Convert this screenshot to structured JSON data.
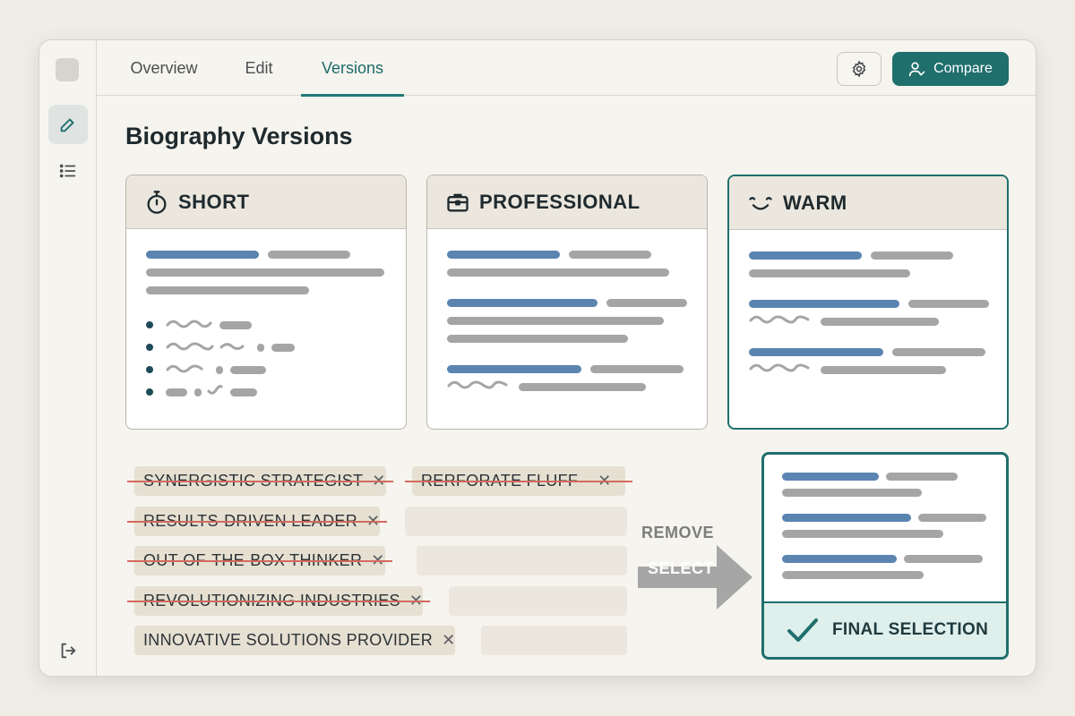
{
  "nav": {
    "tabs": [
      {
        "label": "Overview"
      },
      {
        "label": "Edit"
      },
      {
        "label": "Versions"
      }
    ],
    "active_tab": "Versions",
    "compare_label": "Compare"
  },
  "page": {
    "title": "Biography Versions"
  },
  "cards": [
    {
      "title": "SHORT",
      "icon": "stopwatch-icon"
    },
    {
      "title": "PROFESSIONAL",
      "icon": "briefcase-icon"
    },
    {
      "title": "WARM",
      "icon": "smile-icon"
    }
  ],
  "buzzwords": [
    {
      "text": "SYNERGISTIC STRATEGIST",
      "removed": true
    },
    {
      "text": "RERFORATE FLUFF",
      "removed": true
    },
    {
      "text": "RESULTS-DRIVEN LEADER",
      "removed": true
    },
    {
      "text": "OUT-OF-THE-BOX THINKER",
      "removed": true
    },
    {
      "text": "REVOLUTIONIZING INDUSTRIES",
      "removed": true
    },
    {
      "text": "INNOVATIVE SOLUTIONS PROVIDER",
      "removed": false
    }
  ],
  "flow": {
    "remove_label": "REMOVE",
    "select_label": "SELECT"
  },
  "final": {
    "label": "FINAL SELECTION"
  },
  "colors": {
    "accent": "#1f6f6d",
    "strike": "#d46a5e",
    "text_line_blue": "#5b84b1",
    "text_line_grey": "#a5a5a5"
  }
}
